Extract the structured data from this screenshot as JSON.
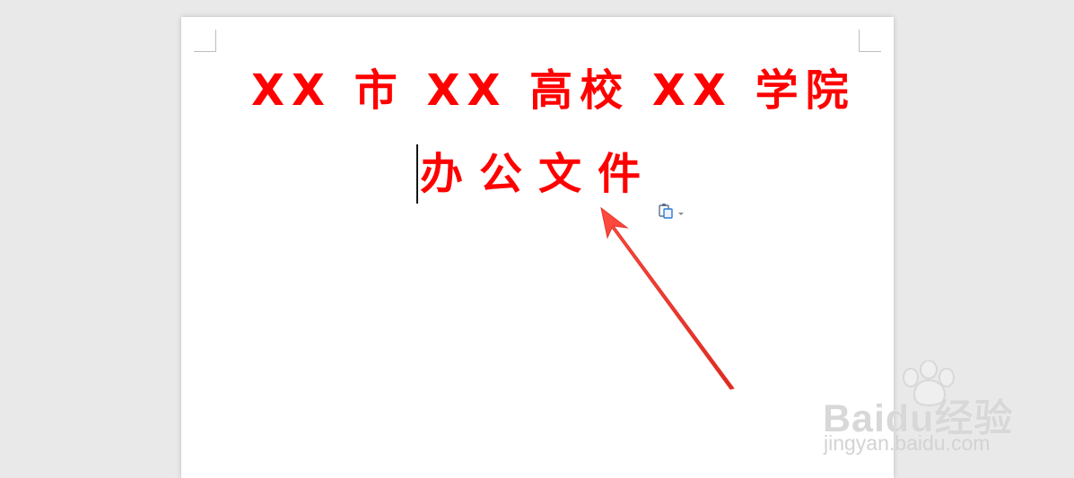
{
  "document": {
    "title_line": "XX 市 XX 高校 XX 学院",
    "subtitle_line": "办公文件"
  },
  "icons": {
    "paste": "paste-options-icon",
    "dropdown": "chevron-down-icon",
    "annotation": "red-arrow-icon",
    "watermark_logo": "baidu-paw-icon"
  },
  "colors": {
    "heading": "#ff0000",
    "arrow": "#f03a2e",
    "workspace": "#e9e9e9",
    "page": "#ffffff",
    "watermark": "#d8d8d8"
  },
  "watermark": {
    "brand": "Baidu经验",
    "url": "jingyan.baidu.com"
  }
}
